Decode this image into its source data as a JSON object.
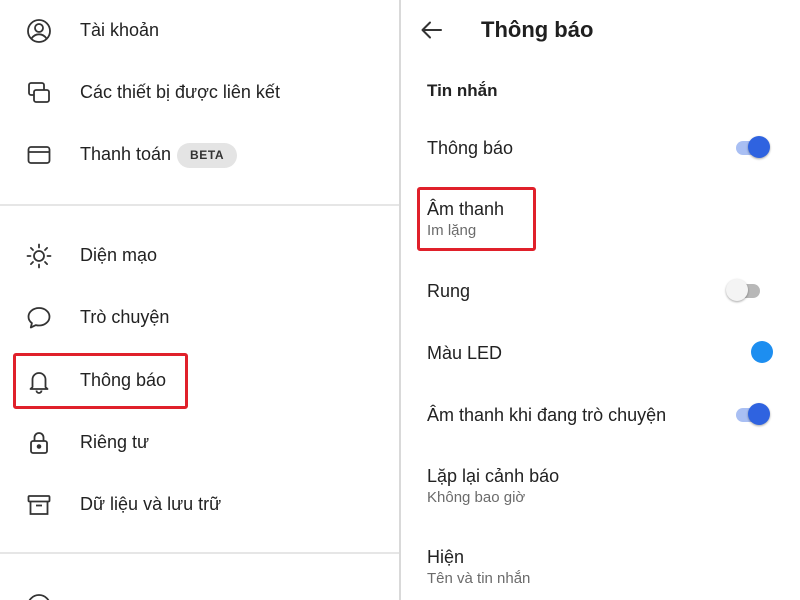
{
  "left_menu": {
    "account_label": "Tài khoản",
    "linked_devices_label": "Các thiết bị được liên kết",
    "payments_label": "Thanh toán",
    "payments_badge": "BETA",
    "appearance_label": "Diện mạo",
    "chats_label": "Trò chuyện",
    "notifications_label": "Thông báo",
    "privacy_label": "Riêng tư",
    "data_storage_label": "Dữ liệu và lưu trữ"
  },
  "notifications_screen": {
    "title": "Thông báo",
    "section_header": "Tin nhắn",
    "settings": {
      "notifications": {
        "title": "Thông báo",
        "enabled": true
      },
      "sound": {
        "title": "Âm thanh",
        "value": "Im lặng"
      },
      "vibrate": {
        "title": "Rung",
        "enabled": false
      },
      "led_color": {
        "title": "Màu LED",
        "color": "#1d8ef0"
      },
      "in_chat_sounds": {
        "title": "Âm thanh khi đang trò chuyện",
        "enabled": true
      },
      "repeat_alerts": {
        "title": "Lặp lại cảnh báo",
        "value": "Không bao giờ"
      },
      "show": {
        "title": "Hiện",
        "value": "Tên và tin nhắn"
      }
    }
  },
  "colors": {
    "toggle_on": "#2f63e0",
    "toggle_on_track": "#a9bff3",
    "highlight": "#e0202a"
  },
  "icons": [
    "account-icon",
    "linked-devices-icon",
    "payment-card-icon",
    "appearance-icon",
    "chat-bubble-icon",
    "bell-icon",
    "lock-icon",
    "archive-icon",
    "back-arrow-icon"
  ]
}
